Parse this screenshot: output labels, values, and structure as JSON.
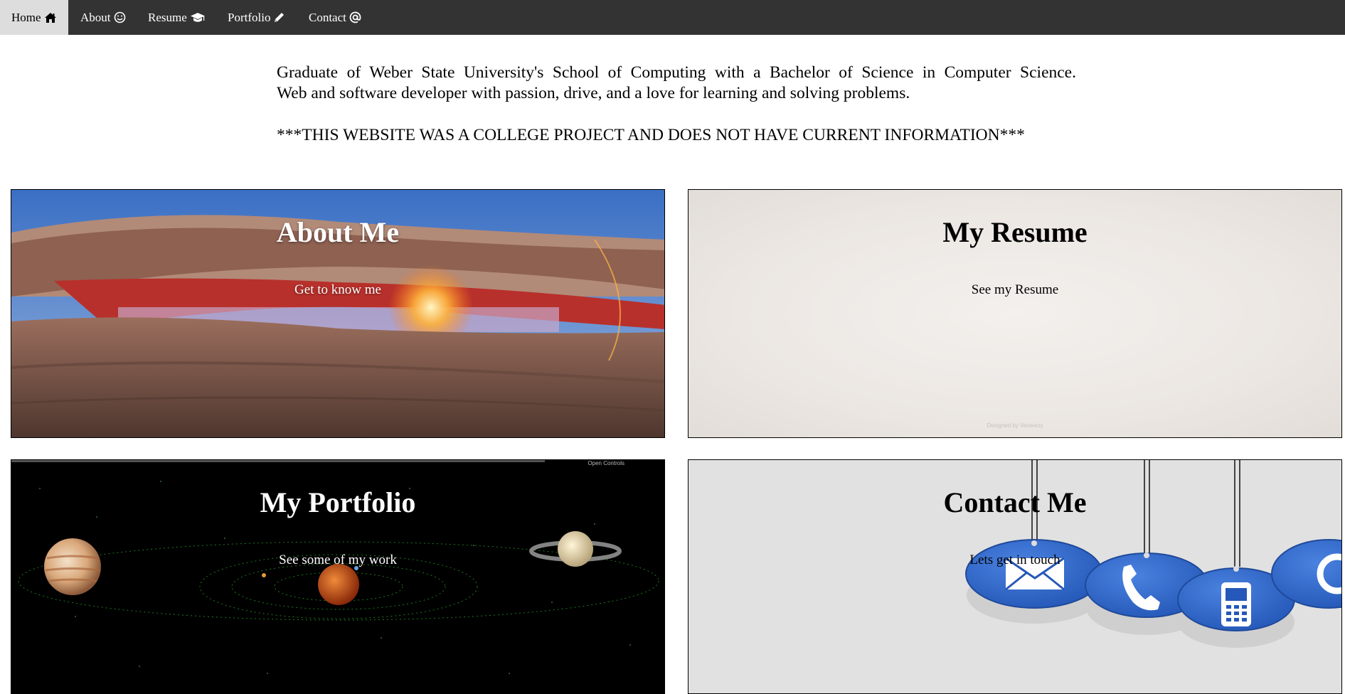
{
  "nav": {
    "items": [
      {
        "label": "Home",
        "icon": "home-icon",
        "active": true
      },
      {
        "label": "About",
        "icon": "smile-icon",
        "active": false
      },
      {
        "label": "Resume",
        "icon": "graduation-cap-icon",
        "active": false
      },
      {
        "label": "Portfolio",
        "icon": "pencil-icon",
        "active": false
      },
      {
        "label": "Contact",
        "icon": "at-icon",
        "active": false
      }
    ]
  },
  "intro": {
    "line1": "Graduate of Weber State University's School of Computing with a Bachelor of Science in Computer Science.",
    "line2": "Web and software developer with passion, drive, and a love for learning and solving problems.",
    "disclaimer": "***THIS WEBSITE WAS A COLLEGE PROJECT AND DOES NOT HAVE CURRENT INFORMATION***"
  },
  "cards": {
    "about": {
      "title": "About Me",
      "subtitle": "Get to know me"
    },
    "resume": {
      "title": "My Resume",
      "subtitle": "See my Resume",
      "watermark": "Designed by Vecteezy"
    },
    "portfolio": {
      "title": "My Portfolio",
      "subtitle": "See some of my work",
      "controls": "Open Controls"
    },
    "contact": {
      "title": "Contact Me",
      "subtitle": "Lets get in touch"
    }
  },
  "colors": {
    "nav_bg": "#333333",
    "nav_active_bg": "#dddddd",
    "nav_text": "#ffffff"
  }
}
